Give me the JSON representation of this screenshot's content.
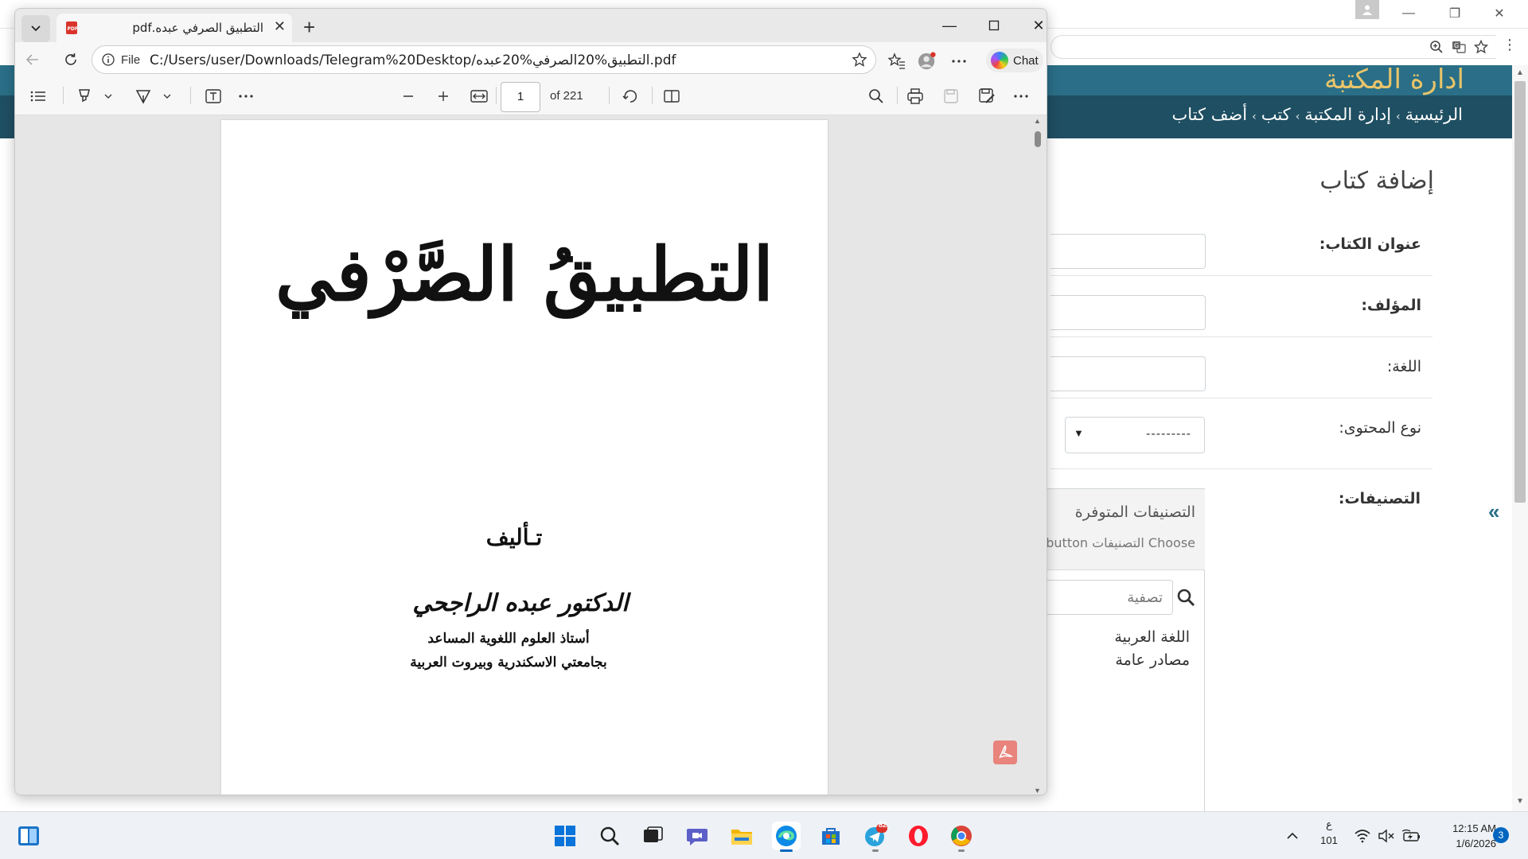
{
  "background_site": {
    "site_title": "ادارة المكتبة",
    "breadcrumb": [
      "الرئيسية",
      "إدارة المكتبة",
      "كتب",
      "أضف كتاب"
    ],
    "page_heading": "إضافة كتاب",
    "fields": [
      {
        "label": "عنوان الكتاب:"
      },
      {
        "label": "المؤلف:"
      },
      {
        "label": "اللغة:"
      },
      {
        "label": "نوع المحتوى:",
        "select_value": "---------"
      }
    ],
    "categories": {
      "label": "التصنيفات:",
      "box_title": "التصنيفات المتوفرة",
      "help_text": "Choose التصنيفات button",
      "filter_placeholder": "تصفية",
      "items": [
        "اللغة العربية",
        "مصادر عامة"
      ]
    }
  },
  "edge": {
    "tab_title": "التطبيق الصرفي عبده.pdf",
    "omnibox": {
      "scheme_label": "File",
      "url": "C:/Users/user/Downloads/Telegram%20Desktop/التطبيق%20الصرفي%20عبده.pdf"
    },
    "chat_label": "Chat",
    "pdf_toolbar": {
      "page_number": "1",
      "page_total": "of 221"
    },
    "pdf_page": {
      "title": "التطبيقُ الصَّرْفي",
      "by": "تـأليف",
      "author": "الدكتور عبده الراجحي",
      "subtitle_line1": "أستاذ العلوم اللغوية المساعد",
      "subtitle_line2": "بجامعتي الاسكندرية وبيروت العربية"
    }
  },
  "taskbar": {
    "lang_line1": "ع",
    "lang_line2": "101",
    "telegram_badge": "82",
    "time": "12:15 AM",
    "date": "1/6/2026",
    "notifications": "3"
  },
  "colors": {
    "site_header": "#1f4f62",
    "site_title": "#e9c46a",
    "taskbar": "#eef1f5",
    "accent": "#0067c0"
  }
}
